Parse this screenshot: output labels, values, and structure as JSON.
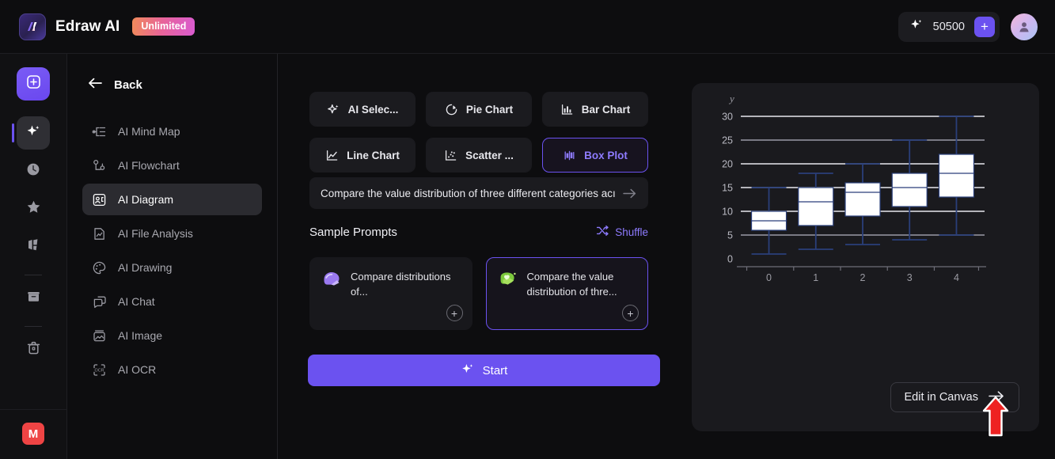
{
  "topbar": {
    "brand_name": "Edraw AI",
    "badge": "Unlimited",
    "credits": "50500",
    "plus_label": "+",
    "logo_icon": "edraw-logo-icon",
    "credits_icon": "sparkle-icon",
    "avatar_icon": "user-avatar-icon"
  },
  "rail": {
    "items": [
      {
        "name": "new-document",
        "icon": "plus-square-icon"
      },
      {
        "name": "ai-tools",
        "icon": "sparkle-icon"
      },
      {
        "name": "recent",
        "icon": "clock-icon"
      },
      {
        "name": "favorites",
        "icon": "star-icon"
      },
      {
        "name": "templates",
        "icon": "templates-icon"
      },
      {
        "name": "archive",
        "icon": "box-icon"
      },
      {
        "name": "trash",
        "icon": "trash-icon"
      }
    ],
    "bottom_badge": "M"
  },
  "sidebar": {
    "back_label": "Back",
    "back_icon": "arrow-left-icon",
    "items": [
      {
        "label": "AI Mind Map",
        "icon": "mind-map-icon",
        "selected": false
      },
      {
        "label": "AI Flowchart",
        "icon": "flowchart-icon",
        "selected": false
      },
      {
        "label": "AI Diagram",
        "icon": "diagram-icon",
        "selected": true
      },
      {
        "label": "AI File Analysis",
        "icon": "file-analysis-icon",
        "selected": false
      },
      {
        "label": "AI Drawing",
        "icon": "palette-icon",
        "selected": false
      },
      {
        "label": "AI Chat",
        "icon": "chat-icon",
        "selected": false
      },
      {
        "label": "AI Image",
        "icon": "image-icon",
        "selected": false
      },
      {
        "label": "AI OCR",
        "icon": "ocr-icon",
        "selected": false
      }
    ]
  },
  "main": {
    "chart_types": [
      {
        "label": "AI Selec...",
        "icon": "sparkle-icon",
        "active": false
      },
      {
        "label": "Pie Chart",
        "icon": "pie-chart-icon",
        "active": false
      },
      {
        "label": "Bar Chart",
        "icon": "bar-chart-icon",
        "active": false
      },
      {
        "label": "Line Chart",
        "icon": "line-chart-icon",
        "active": false
      },
      {
        "label": "Scatter ...",
        "icon": "scatter-chart-icon",
        "active": false
      },
      {
        "label": "Box Plot",
        "icon": "box-plot-icon",
        "active": true
      }
    ],
    "prompt_value": "Compare the value distribution of three different categories acı",
    "prompt_submit_icon": "arrow-right-icon",
    "sample_prompts_title": "Sample Prompts",
    "shuffle_label": "Shuffle",
    "shuffle_icon": "shuffle-icon",
    "cards": [
      {
        "text": "Compare distributions of...",
        "emoji": "purple-chat-bubble-icon",
        "add_label": "+",
        "selected": false
      },
      {
        "text": "Compare the value distribution of thre...",
        "emoji": "green-chat-bubble-icon",
        "add_label": "+",
        "selected": true
      }
    ],
    "start_label": "Start",
    "start_icon": "sparkle-icon"
  },
  "preview": {
    "edit_label": "Edit in Canvas",
    "edit_icon": "arrow-right-icon",
    "annotation_icon": "red-up-arrow-icon"
  },
  "colors": {
    "accent": "#6b52f0",
    "accent_text": "#8e7bff",
    "panel": "#1a1a1e",
    "surface": "#1b1b1f",
    "background": "#0d0d0f",
    "box_stroke": "#2a3f7a",
    "box_fill": "#ffffff",
    "grid": "#e8e8ee",
    "annotation_red": "#ee2222"
  },
  "chart_data": {
    "type": "box",
    "title": "",
    "xlabel": "",
    "ylabel": "y",
    "xlim": [
      -0.6,
      4.6
    ],
    "ylim": [
      0,
      31
    ],
    "yticks": [
      0,
      5,
      10,
      15,
      20,
      25,
      30
    ],
    "xticks": [
      0,
      1,
      2,
      3,
      4
    ],
    "categories": [
      "0",
      "1",
      "2",
      "3",
      "4"
    ],
    "grid": true,
    "legend": "none",
    "boxes": [
      {
        "category": "0",
        "whisker_low": 1,
        "q1": 6,
        "median": 8,
        "q3": 10,
        "whisker_high": 15
      },
      {
        "category": "1",
        "whisker_low": 2,
        "q1": 7,
        "median": 12,
        "q3": 15,
        "whisker_high": 18
      },
      {
        "category": "2",
        "whisker_low": 3,
        "q1": 9,
        "median": 14,
        "q3": 16,
        "whisker_high": 20
      },
      {
        "category": "3",
        "whisker_low": 4,
        "q1": 11,
        "median": 15,
        "q3": 18,
        "whisker_high": 25
      },
      {
        "category": "4",
        "whisker_low": 5,
        "q1": 13,
        "median": 18,
        "q3": 22,
        "whisker_high": 30
      }
    ]
  }
}
